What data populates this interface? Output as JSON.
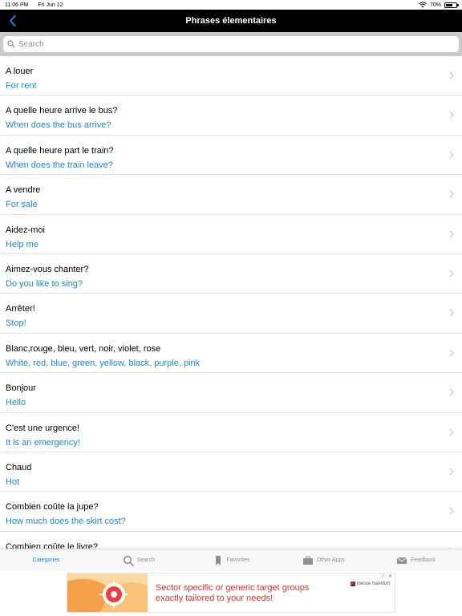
{
  "status": {
    "time": "11:06 PM",
    "date": "Fri Jun 12",
    "battery": "70%",
    "battery_level": 0.7
  },
  "nav": {
    "title": "Phrases élementaires"
  },
  "search": {
    "placeholder": "Search"
  },
  "phrases": [
    {
      "fr": "A louer",
      "en": "For rent"
    },
    {
      "fr": "A quelle heure arrive le bus?",
      "en": "When does the bus arrive?"
    },
    {
      "fr": "A quelle heure part le train?",
      "en": "When does the train leave?"
    },
    {
      "fr": "A vendre",
      "en": "For sale"
    },
    {
      "fr": "Aidez-moi",
      "en": "Help me"
    },
    {
      "fr": "Aimez-vous chanter?",
      "en": "Do you like to sing?"
    },
    {
      "fr": "Arrêter!",
      "en": "Stop!"
    },
    {
      "fr": "Blanc,rouge, bleu, vert, noir, violet, rose",
      "en": "White, red, blue, green, yellow, black, purple, pink"
    },
    {
      "fr": "Bonjour",
      "en": "Hello"
    },
    {
      "fr": "C'est une urgence!",
      "en": "It is an emergency!"
    },
    {
      "fr": "Chaud",
      "en": "Hot"
    },
    {
      "fr": "Combien coûte la jupe?",
      "en": "How much does the skirt cost?"
    },
    {
      "fr": "Combien coûte le livre?",
      "en": ""
    }
  ],
  "tabs": [
    {
      "label": "Categories",
      "icon": "categories-icon",
      "active": true
    },
    {
      "label": "Search",
      "icon": "search-icon",
      "active": false
    },
    {
      "label": "Favorites",
      "icon": "bookmark-icon",
      "active": false
    },
    {
      "label": "Other Apps",
      "icon": "briefcase-icon",
      "active": false
    },
    {
      "label": "Feedback",
      "icon": "envelope-icon",
      "active": false
    }
  ],
  "ad": {
    "line1": "Sector specific or generic target groups",
    "line2": "exactly tailored to your needs!",
    "brand": "messe frankfurt"
  },
  "colors": {
    "accent": "#1a86e0",
    "nav_bg": "#000000",
    "ad_text": "#e0312b"
  }
}
